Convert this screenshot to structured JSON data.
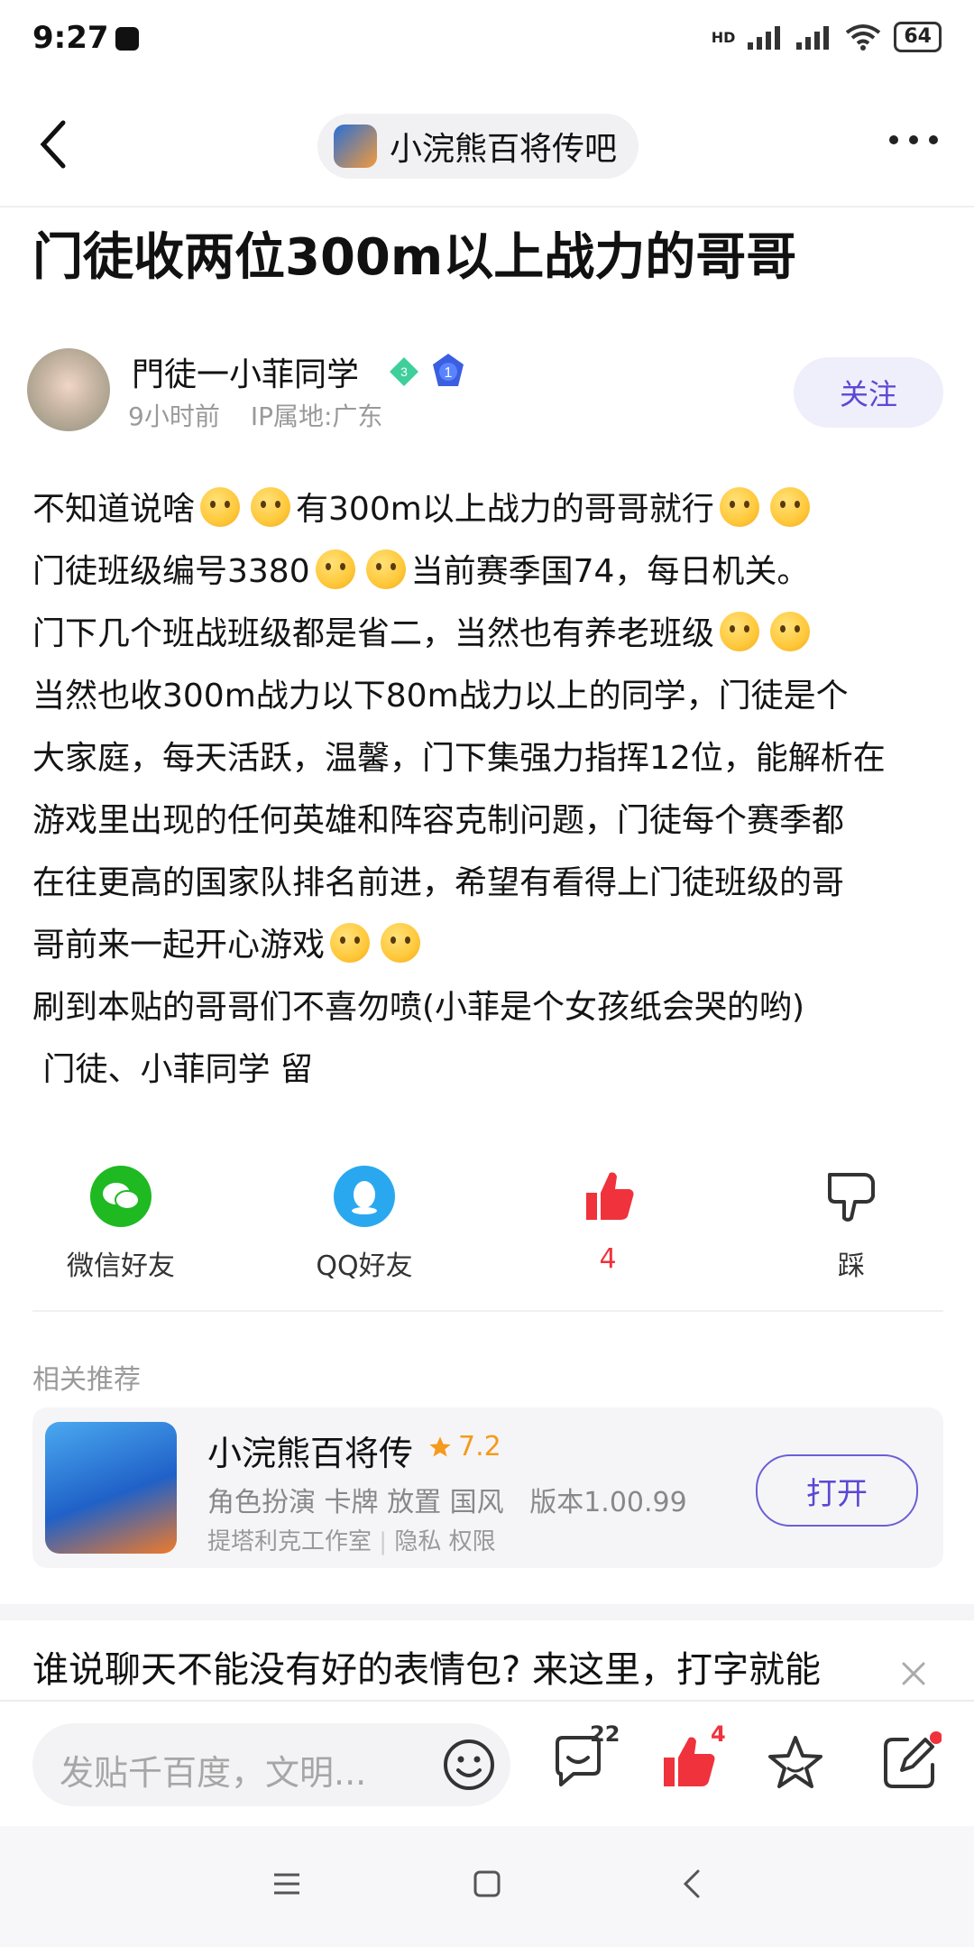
{
  "status_bar": {
    "time": "9:27",
    "network": "HD",
    "battery": "64"
  },
  "nav": {
    "forum_name": "小浣熊百将传吧"
  },
  "post": {
    "title": "门徒收两位300m以上战力的哥哥",
    "author": {
      "name": "門徒一小菲同学",
      "level": "3",
      "rank_badge": "1",
      "time": "9小时前",
      "ip": "IP属地:广东"
    },
    "follow_label": "关注",
    "lines": [
      [
        "不知道说啥",
        "emoji",
        "emoji",
        "有300m以上战力的哥哥就行",
        "emoji",
        "emoji"
      ],
      [
        "门徒班级编号3380",
        "emoji",
        "emoji",
        "当前赛季国74，每日机关。"
      ],
      [
        "门下几个班战班级都是省二，当然也有养老班级",
        "emoji",
        "emoji"
      ],
      [
        "当然也收300m战力以下80m战力以上的同学，门徒是个"
      ],
      [
        "大家庭，每天活跃，温馨，门下集强力指挥12位，能解析在"
      ],
      [
        "游戏里出现的任何英雄和阵容克制问题，门徒每个赛季都"
      ],
      [
        "在往更高的国家队排名前进，希望有看得上门徒班级的哥"
      ],
      [
        "哥前来一起开心游戏",
        "emoji",
        "emoji"
      ],
      [
        "刷到本贴的哥哥们不喜勿喷(小菲是个女孩纸会哭的哟)"
      ],
      [
        " 门徒、小菲同学 留"
      ]
    ]
  },
  "share": {
    "wechat": "微信好友",
    "qq": "QQ好友",
    "like_count": "4",
    "dislike": "踩"
  },
  "recommend": {
    "section_title": "相关推荐",
    "app_name": "小浣熊百将传",
    "rating": "7.2",
    "tags": "角色扮演 卡牌 放置 国风",
    "version": "版本1.00.99",
    "developer": "提塔利克工作室",
    "privacy": "隐私",
    "permissions": "权限",
    "open_label": "打开"
  },
  "ad": {
    "text": "谁说聊天不能没有好的表情包? 来这里，打字就能"
  },
  "bottom_bar": {
    "input_placeholder": "发贴千百度，文明...",
    "comment_count": "22",
    "like_count": "4"
  },
  "colors": {
    "accent": "#5b48d4",
    "like_red": "#f0323c",
    "wechat_green": "#1fb922",
    "qq_blue": "#29a8f0"
  }
}
